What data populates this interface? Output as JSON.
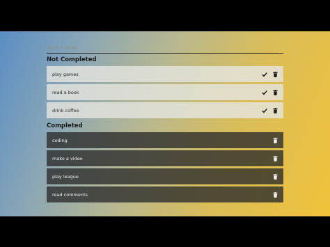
{
  "input": {
    "placeholder": "ADD A TASK"
  },
  "sections": {
    "not_completed_title": "Not Completed",
    "completed_title": "Completed"
  },
  "not_completed": [
    {
      "text": "play games"
    },
    {
      "text": "read a book"
    },
    {
      "text": "drink coffee"
    }
  ],
  "completed": [
    {
      "text": "coding"
    },
    {
      "text": "make a video"
    },
    {
      "text": "play league"
    },
    {
      "text": "read comments"
    }
  ],
  "icons": {
    "complete": "check-icon",
    "delete": "trash-icon"
  },
  "colors": {
    "open_item_bg": "#e4e4de",
    "done_item_bg": "#2a2a2a",
    "gradient_start": "#5a8ec4",
    "gradient_end": "#f0c23a"
  }
}
